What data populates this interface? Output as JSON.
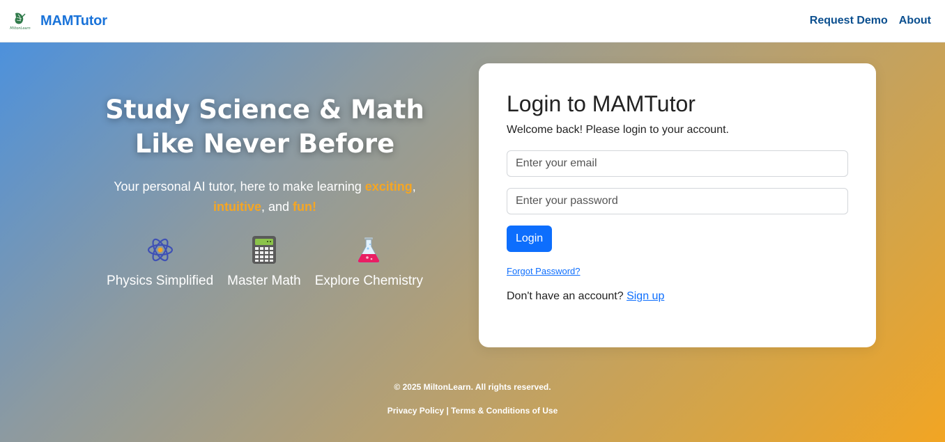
{
  "header": {
    "brand": "MAMTutor",
    "logo_text": "MiltonLearn",
    "nav": [
      {
        "label": "Request Demo"
      },
      {
        "label": "About"
      }
    ]
  },
  "hero": {
    "headline_line1": "Study Science & Math",
    "headline_line2": "Like Never Before",
    "tagline": {
      "prefix": "Your personal AI tutor, here to make learning ",
      "word1": "exciting",
      "sep1": ", ",
      "word2": "intuitive",
      "sep2": ", and ",
      "word3": "fun!"
    },
    "features": [
      {
        "label": "Physics Simplified",
        "icon": "atom-icon"
      },
      {
        "label": "Master Math",
        "icon": "calculator-icon"
      },
      {
        "label": "Explore Chemistry",
        "icon": "flask-icon"
      }
    ]
  },
  "login": {
    "title": "Login to MAMTutor",
    "subtitle": "Welcome back! Please login to your account.",
    "email_placeholder": "Enter your email",
    "password_placeholder": "Enter your password",
    "button": "Login",
    "forgot": "Forgot Password?",
    "signup_prompt": "Don't have an account?",
    "signup_link": "Sign up"
  },
  "footer": {
    "copyright": "© 2025 MiltonLearn. All rights reserved.",
    "privacy": "Privacy Policy",
    "separator": "|",
    "terms": "Terms & Conditions of Use"
  },
  "colors": {
    "brand_blue": "#1a73d9",
    "nav_link": "#0b4f8f",
    "highlight_orange": "#f5a623",
    "primary_button": "#0d6efd"
  }
}
